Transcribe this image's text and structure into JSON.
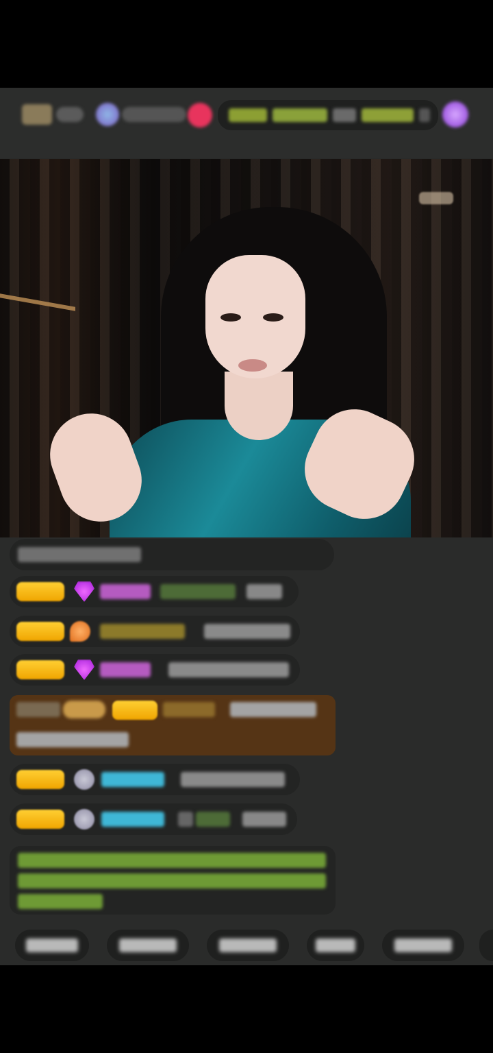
{
  "top_bar": {
    "colors": {
      "background": "#2c2d2c",
      "pill_green": "#8ea037",
      "avatar_red": "#e8345d",
      "gift_purple": "#8a3bd6"
    },
    "icons": [
      "platform-logo-icon",
      "host-avatar-icon",
      "follow-red-icon",
      "gift-icon"
    ]
  },
  "chat": {
    "colors": {
      "badge_gold": "#f0a500",
      "highlight_bg": "#553415",
      "bubble_bg": "#232423",
      "green_text": "#8cbf3a",
      "cyan_name": "#3fb7d6"
    },
    "icons": [
      "gem-purple-icon",
      "gem-orange-icon",
      "gem-purple-icon",
      "gem-gray-icon",
      "gem-gray-icon"
    ]
  },
  "quick_bar": {
    "button_count_visible": 5
  }
}
